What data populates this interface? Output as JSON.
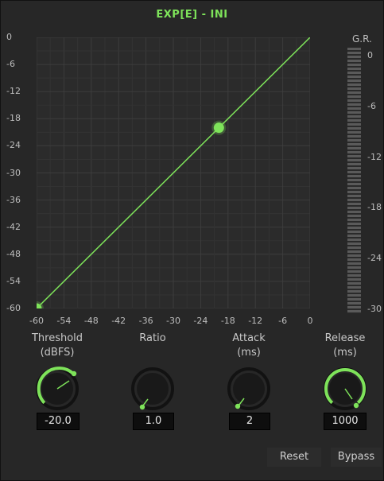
{
  "title": "EXP[E] - INI",
  "accent_color": "#7ee35a",
  "graph": {
    "y_ticks": [
      "0",
      "-6",
      "-12",
      "-18",
      "-24",
      "-30",
      "-36",
      "-42",
      "-48",
      "-54",
      "-60"
    ],
    "x_ticks": [
      "-60",
      "-54",
      "-48",
      "-42",
      "-36",
      "-30",
      "-24",
      "-18",
      "-12",
      "-6",
      "0"
    ],
    "curve": {
      "x": [
        -60,
        0
      ],
      "y": [
        -60,
        0
      ]
    },
    "handles": [
      {
        "x": -60,
        "y": -60
      },
      {
        "x": -20,
        "y": -20
      }
    ]
  },
  "gr_meter": {
    "title": "G.R.",
    "ticks": [
      "0",
      "-6",
      "-12",
      "-18",
      "-24",
      "-30"
    ]
  },
  "knobs": [
    {
      "id": "threshold",
      "title_line1": "Threshold",
      "title_line2": "(dBFS)",
      "value": "-20.0"
    },
    {
      "id": "ratio",
      "title_line1": "Ratio",
      "title_line2": "",
      "value": "1.0"
    },
    {
      "id": "attack",
      "title_line1": "Attack",
      "title_line2": "(ms)",
      "value": "2"
    },
    {
      "id": "release",
      "title_line1": "Release",
      "title_line2": "(ms)",
      "value": "1000"
    }
  ],
  "buttons": {
    "reset": "Reset",
    "bypass": "Bypass"
  }
}
